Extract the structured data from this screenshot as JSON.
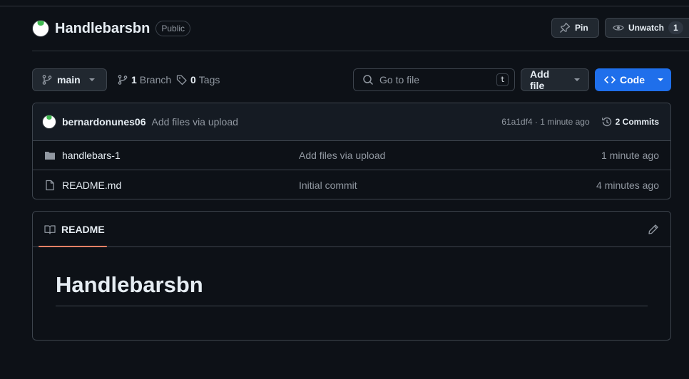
{
  "repo": {
    "name": "Handlebarsbn",
    "visibility": "Public"
  },
  "header_actions": {
    "pin_label": "Pin",
    "unwatch_label": "Unwatch",
    "unwatch_count": "1"
  },
  "toolbar": {
    "branch_name": "main",
    "branch_count": "1",
    "branch_label": "Branch",
    "tag_count": "0",
    "tag_label": "Tags",
    "search_placeholder": "Go to file",
    "search_shortcut": "t",
    "add_file_label": "Add file",
    "code_label": "Code"
  },
  "latest_commit": {
    "author": "bernardonunes06",
    "message": "Add files via upload",
    "meta": "61a1df4 · 1 minute ago",
    "commits_label": "2 Commits"
  },
  "files": [
    {
      "name": "handlebars-1",
      "type": "folder",
      "message": "Add files via upload",
      "time": "1 minute ago"
    },
    {
      "name": "README.md",
      "type": "file",
      "message": "Initial commit",
      "time": "4 minutes ago"
    }
  ],
  "readme": {
    "tab_label": "README",
    "heading": "Handlebarsbn"
  },
  "colors": {
    "background": "#0d1117",
    "accent_blue": "#1f6feb",
    "tab_underline": "#f78166",
    "folder_icon": "#9198a1"
  }
}
